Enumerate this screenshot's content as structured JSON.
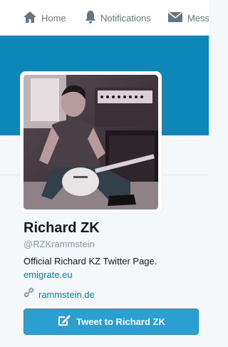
{
  "nav": {
    "items": [
      {
        "label": "Home",
        "icon": "home-icon"
      },
      {
        "label": "Notifications",
        "icon": "bell-icon"
      },
      {
        "label": "Messa",
        "icon": "envelope-icon"
      }
    ]
  },
  "profile": {
    "name": "Richard ZK",
    "handle": "@RZKrammstein",
    "bio": "Official Richard KZ Twitter Page.",
    "bio_link": "emigrate.eu",
    "website": "rammstein.de",
    "website_icon": "link-icon"
  },
  "tweet_button": {
    "label": "Tweet to Richard ZK",
    "icon": "compose-icon"
  },
  "colors": {
    "banner": "#0f86b8",
    "link": "#0084b4",
    "button": "#2b9fd0"
  }
}
